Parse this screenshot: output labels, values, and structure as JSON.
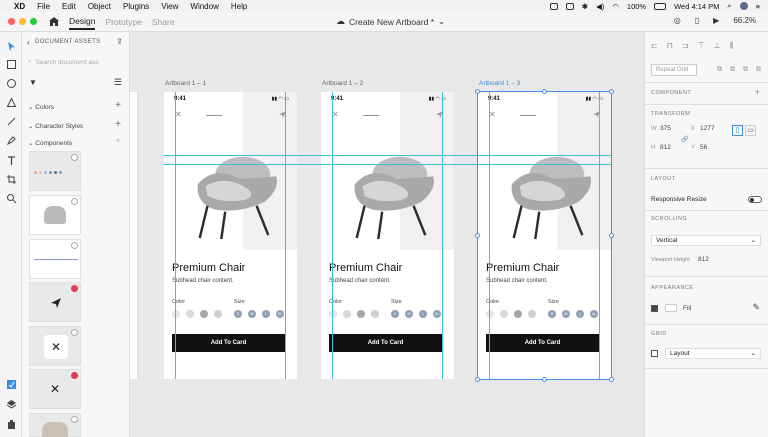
{
  "menubar": {
    "app": "XD",
    "items": [
      "File",
      "Edit",
      "Object",
      "Plugins",
      "View",
      "Window",
      "Help"
    ],
    "battery": "100%",
    "clock": "Wed 4:14 PM"
  },
  "titlebar": {
    "tabs": [
      "Design",
      "Prototype",
      "Share"
    ],
    "document_title": "Create New Artboard *",
    "zoom": "66.2%"
  },
  "assets": {
    "header": "DOCUMENT ASSETS",
    "search_placeholder": "Search document ass",
    "sections": [
      "Colors",
      "Character Styles",
      "Components"
    ]
  },
  "artboards": [
    {
      "label": "Artboard 1 – 1",
      "selected": false
    },
    {
      "label": "Artboard 1 – 2",
      "selected": false
    },
    {
      "label": "Artboard 1 – 3",
      "selected": true
    }
  ],
  "product": {
    "time": "9:41",
    "title": "Premium Chair",
    "subtitle": "Subhead chair content.",
    "color_label": "Color",
    "size_label": "Size",
    "sizes": [
      "S",
      "M",
      "L",
      "XL"
    ],
    "cta": "Add To Card",
    "swatch_colors": [
      "#e6e6e6",
      "#d9d9d9",
      "#a6a6a6",
      "#cfcfcf"
    ],
    "size_color": "#8ea0b8"
  },
  "inspector": {
    "repeat_grid": "Repeat Grid",
    "component_label": "COMPONENT",
    "transform_label": "TRANSFORM",
    "w_label": "W",
    "w": "375",
    "h_label": "H",
    "h": "812",
    "x_label": "X",
    "x": "1277",
    "y_label": "Y",
    "y": "56",
    "layout_label": "LAYOUT",
    "responsive_resize": "Responsive Resize",
    "scrolling_label": "SCROLLING",
    "scrolling_value": "Vertical",
    "viewport_label": "Viewport Height",
    "viewport_value": "812",
    "appearance_label": "APPEARANCE",
    "fill_label": "Fill",
    "grid_label": "GRID",
    "grid_value": "Layout"
  },
  "colors": {
    "accent": "#4a90e2",
    "guide": "#39c4d6",
    "close_red": "#fe5f57",
    "min_yellow": "#febc2e",
    "max_green": "#28c840"
  }
}
